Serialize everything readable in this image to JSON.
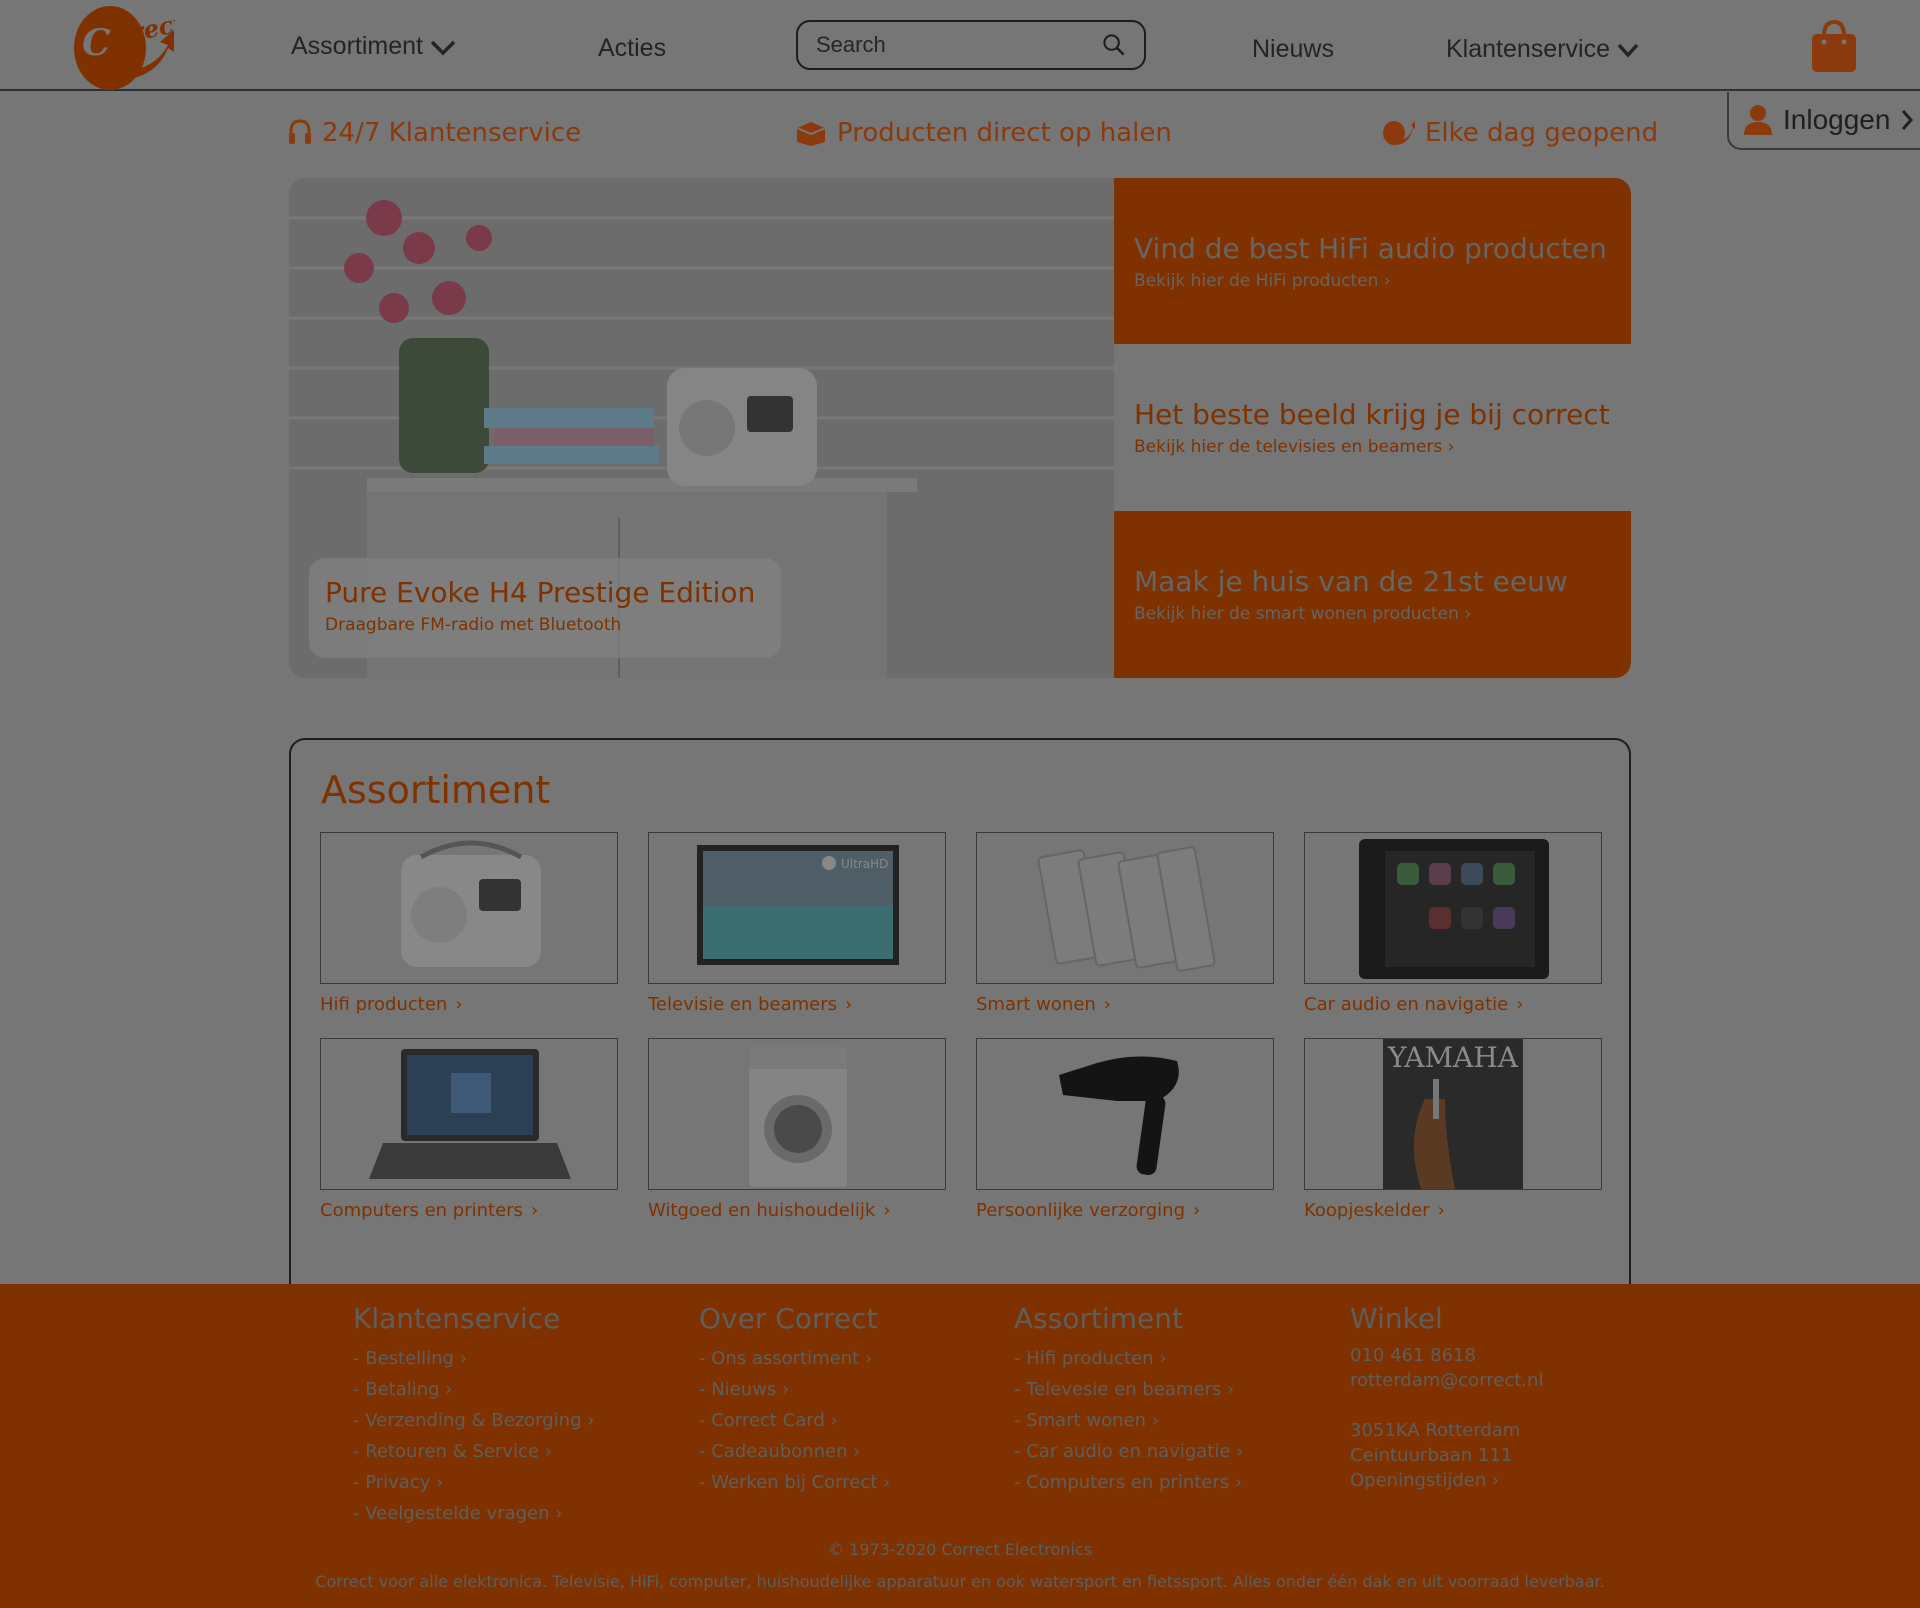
{
  "header": {
    "nav": {
      "assortiment": "Assortiment",
      "acties": "Acties",
      "nieuws": "Nieuws",
      "klantenservice": "Klantenservice"
    },
    "search_placeholder": "Search",
    "login": "Inloggen"
  },
  "usp": [
    "24/7 Klantenservice",
    "Producten direct op halen",
    "Elke dag geopend"
  ],
  "hero": {
    "caption_title": "Pure Evoke H4 Prestige Edition",
    "caption_sub": "Draagbare FM-radio met Bluetooth",
    "tiles": [
      {
        "title": "Vind de best HiFi audio producten",
        "sub": "Bekijk hier de HiFi producten"
      },
      {
        "title": "Het beste beeld krijg je bij correct",
        "sub": "Bekijk hier de televisies en beamers"
      },
      {
        "title": "Maak je huis van de 21st eeuw",
        "sub": "Bekijk hier de smart wonen producten"
      }
    ]
  },
  "assortiment": {
    "title": "Assortiment",
    "categories": [
      "Hifi producten",
      "Televisie en beamers",
      "Smart wonen",
      "Car audio en navigatie",
      "Computers en printers",
      "Witgoed en huishoudelijk",
      "Persoonlijke verzorging",
      "Koopjeskelder"
    ]
  },
  "footer": {
    "klantenservice": {
      "title": "Klantenservice",
      "links": [
        "- Bestelling",
        "- Betaling",
        "- Verzending & Bezorging",
        "- Retouren & Service",
        "- Privacy",
        "- Veelgestelde vragen"
      ]
    },
    "over": {
      "title": "Over Correct",
      "links": [
        "- Ons assortiment",
        "- Nieuws",
        "- Correct Card",
        "- Cadeaubonnen",
        "- Werken bij Correct"
      ]
    },
    "assortiment": {
      "title": "Assortiment",
      "links": [
        "- Hifi producten",
        "- Televesie en beamers",
        "- Smart wonen",
        "- Car audio en navigatie",
        "- Computers en printers"
      ]
    },
    "winkel": {
      "title": "Winkel",
      "phone": "010 461 8618",
      "email": "rotterdam@correct.nl",
      "postcode": "3051KA Rotterdam",
      "street": "Ceintuurbaan 111",
      "hours": "Openingstijden"
    },
    "copyright": "© 1973-2020 Correct Electronics",
    "tagline": "Correct voor alle elektronica. Televisie, HiFi, computer, huishoudelijke apparatuur en ook watersport en fietssport. Alles onder één dak en uit voorraad leverbaar."
  },
  "colors": {
    "brand": "#7f3200",
    "overlay": "#767676"
  }
}
